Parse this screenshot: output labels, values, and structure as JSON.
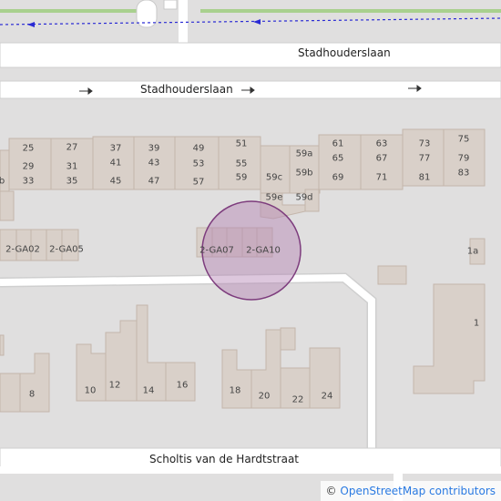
{
  "map": {
    "colors": {
      "background": "#e0dfdf",
      "road": "#ffffff",
      "building": "#d9d0c9",
      "building_outline": "#c4b6ab",
      "footway": "#2b2bd4",
      "grass": "#a9d08e",
      "marker_fill": "#b482b4",
      "marker_stroke": "#7d3c7d"
    },
    "streets": {
      "top": "Stadhouderslaan",
      "middle": "Stadhouderslaan",
      "bottom": "Scholtis van de Hardtstraat"
    },
    "house_numbers": {
      "n25": "25",
      "n27": "27",
      "n37": "37",
      "n39": "39",
      "n49": "49",
      "n51": "51",
      "n29": "29",
      "n31": "31",
      "n41": "41",
      "n43": "43",
      "n53": "53",
      "n55": "55",
      "n33": "33",
      "n35": "35",
      "n45": "45",
      "n47": "47",
      "n57": "57",
      "n59": "59",
      "n59a": "59a",
      "n59b": "59b",
      "n59c": "59c",
      "n59d": "59d",
      "n59e": "59e",
      "n61": "61",
      "n63": "63",
      "n73": "73",
      "n75": "75",
      "n65": "65",
      "n67": "67",
      "n77": "77",
      "n79": "79",
      "n69": "69",
      "n71": "71",
      "n81": "81",
      "n83": "83",
      "b_left": "b",
      "ga02": "2-GA02",
      "ga05": "2-GA05",
      "ga07": "2-GA07",
      "ga10": "2-GA10",
      "n1a": "1a",
      "n1": "1",
      "n8": "8",
      "n10": "10",
      "n12": "12",
      "n14": "14",
      "n16": "16",
      "n18": "18",
      "n20": "20",
      "n22": "22",
      "n24": "24"
    },
    "attribution": {
      "symbol": "©",
      "text": "OpenStreetMap contributors"
    }
  }
}
